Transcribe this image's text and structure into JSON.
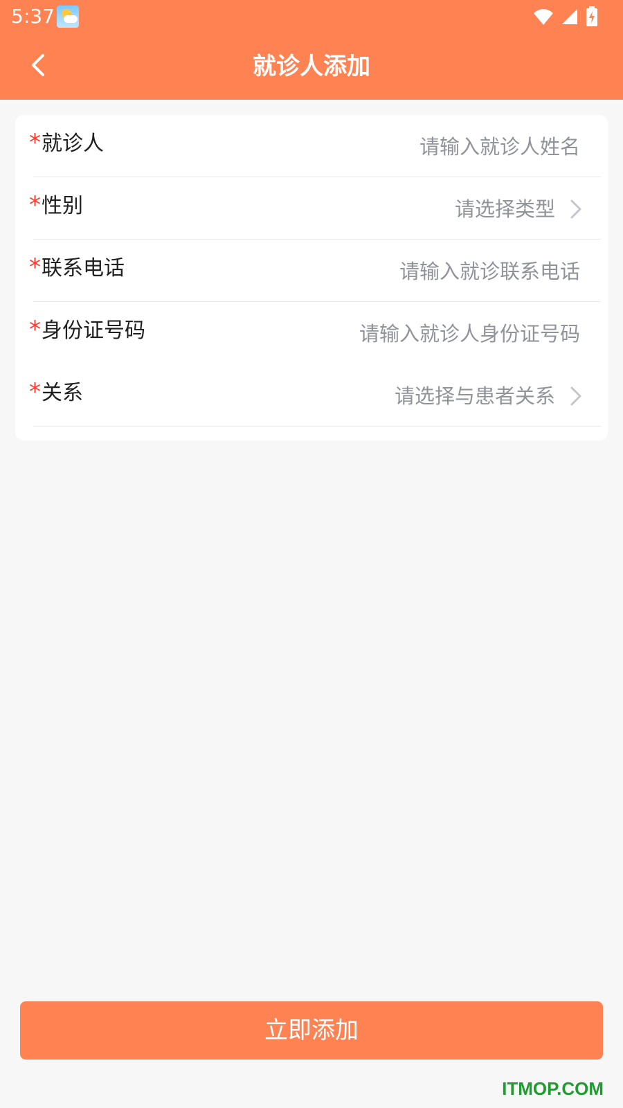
{
  "status_bar": {
    "time": "5:37"
  },
  "header": {
    "title": "就诊人添加"
  },
  "form": {
    "rows": [
      {
        "required_mark": "*",
        "label": "就诊人",
        "placeholder": "请输入就诊人姓名",
        "type": "input"
      },
      {
        "required_mark": "*",
        "label": "性别",
        "placeholder": "请选择类型",
        "type": "select"
      },
      {
        "required_mark": "*",
        "label": "联系电话",
        "placeholder": "请输入就诊联系电话",
        "type": "input"
      },
      {
        "required_mark": "*",
        "label": "身份证号码",
        "placeholder": "请输入就诊人身份证号码",
        "type": "input"
      },
      {
        "required_mark": "*",
        "label": "关系",
        "placeholder": "请选择与患者关系",
        "type": "select"
      }
    ]
  },
  "footer": {
    "submit_label": "立即添加"
  },
  "watermark": "ITMOP.COM",
  "colors": {
    "brand": "#ff8252",
    "required": "#ff3b30",
    "placeholder": "#909399",
    "background": "#f7f7f7"
  }
}
